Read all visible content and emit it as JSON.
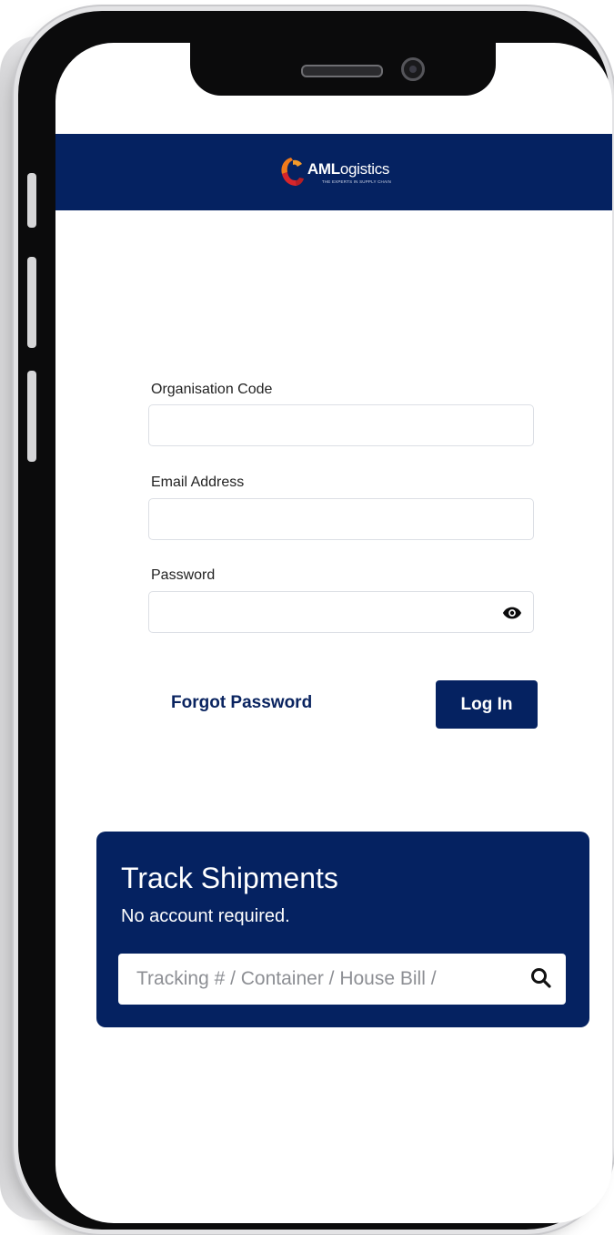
{
  "header": {
    "logo_bold": "AML",
    "logo_rest": "ogistics",
    "tagline": "THE EXPERTS IN SUPPLY CHAIN"
  },
  "form": {
    "org_label": "Organisation Code",
    "org_value": "",
    "email_label": "Email Address",
    "email_value": "",
    "password_label": "Password",
    "password_value": "",
    "forgot_label": "Forgot Password",
    "login_label": "Log In"
  },
  "track": {
    "title": "Track Shipments",
    "subtitle": "No account required.",
    "placeholder": "Tracking # / Container / House Bill /"
  },
  "colors": {
    "brand_navy": "#052261",
    "logo_orange": "#f07a1a",
    "logo_red": "#d7262b"
  },
  "icons": {
    "password_toggle": "eye-icon",
    "search": "search-icon"
  }
}
